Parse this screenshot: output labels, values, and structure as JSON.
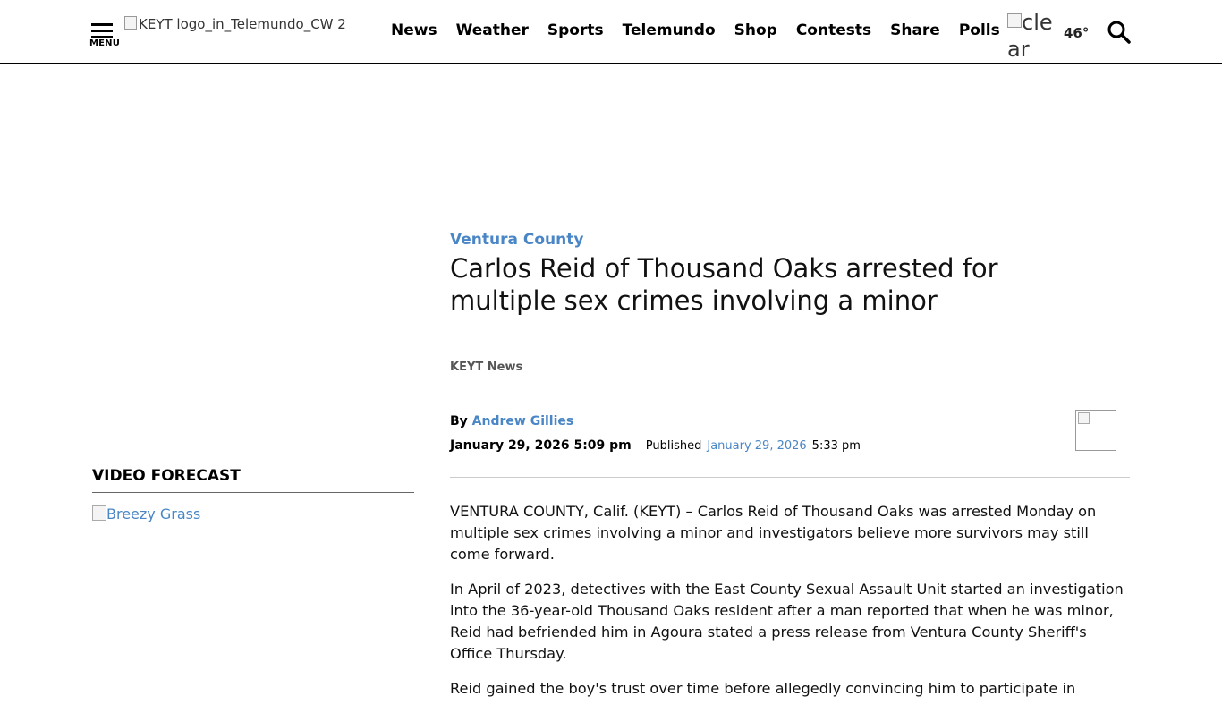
{
  "header": {
    "menu_label": "MENU",
    "logo_alt": "KEYT logo_in_Telemundo_CW 2",
    "nav": [
      "News",
      "Weather",
      "Sports",
      "Telemundo",
      "Shop",
      "Contests",
      "Share",
      "Polls"
    ],
    "weather_alt": "clear",
    "temperature": "46°"
  },
  "sidebar": {
    "video_title": "VIDEO FORECAST",
    "video_alt": "Breezy Grass"
  },
  "article": {
    "category": "Ventura County",
    "title": "Carlos Reid of Thousand Oaks arrested for multiple sex crimes involving a minor",
    "source": "KEYT News",
    "by_label": "By",
    "author": "Andrew Gillies",
    "updated": "January 29, 2026 5:09 pm",
    "published_label": "Published",
    "published_date": "January 29, 2026",
    "published_time": "5:33 pm",
    "paragraphs": [
      "VENTURA COUNTY, Calif. (KEYT) – Carlos Reid of Thousand Oaks was arrested Monday on multiple sex crimes involving a minor and investigators believe more survivors may still come forward.",
      "In April of 2023, detectives with the East County Sexual Assault Unit started an investigation into the 36-year-old Thousand Oaks resident after a man reported that when he was minor, Reid had befriended him in Agoura stated a press release from Ventura County Sheriff's Office Thursday.",
      "Reid gained the boy's trust over time before allegedly convincing him to participate in"
    ]
  },
  "colors": {
    "link": "#4a86c5",
    "text": "#111111",
    "rule": "#cccccc"
  }
}
